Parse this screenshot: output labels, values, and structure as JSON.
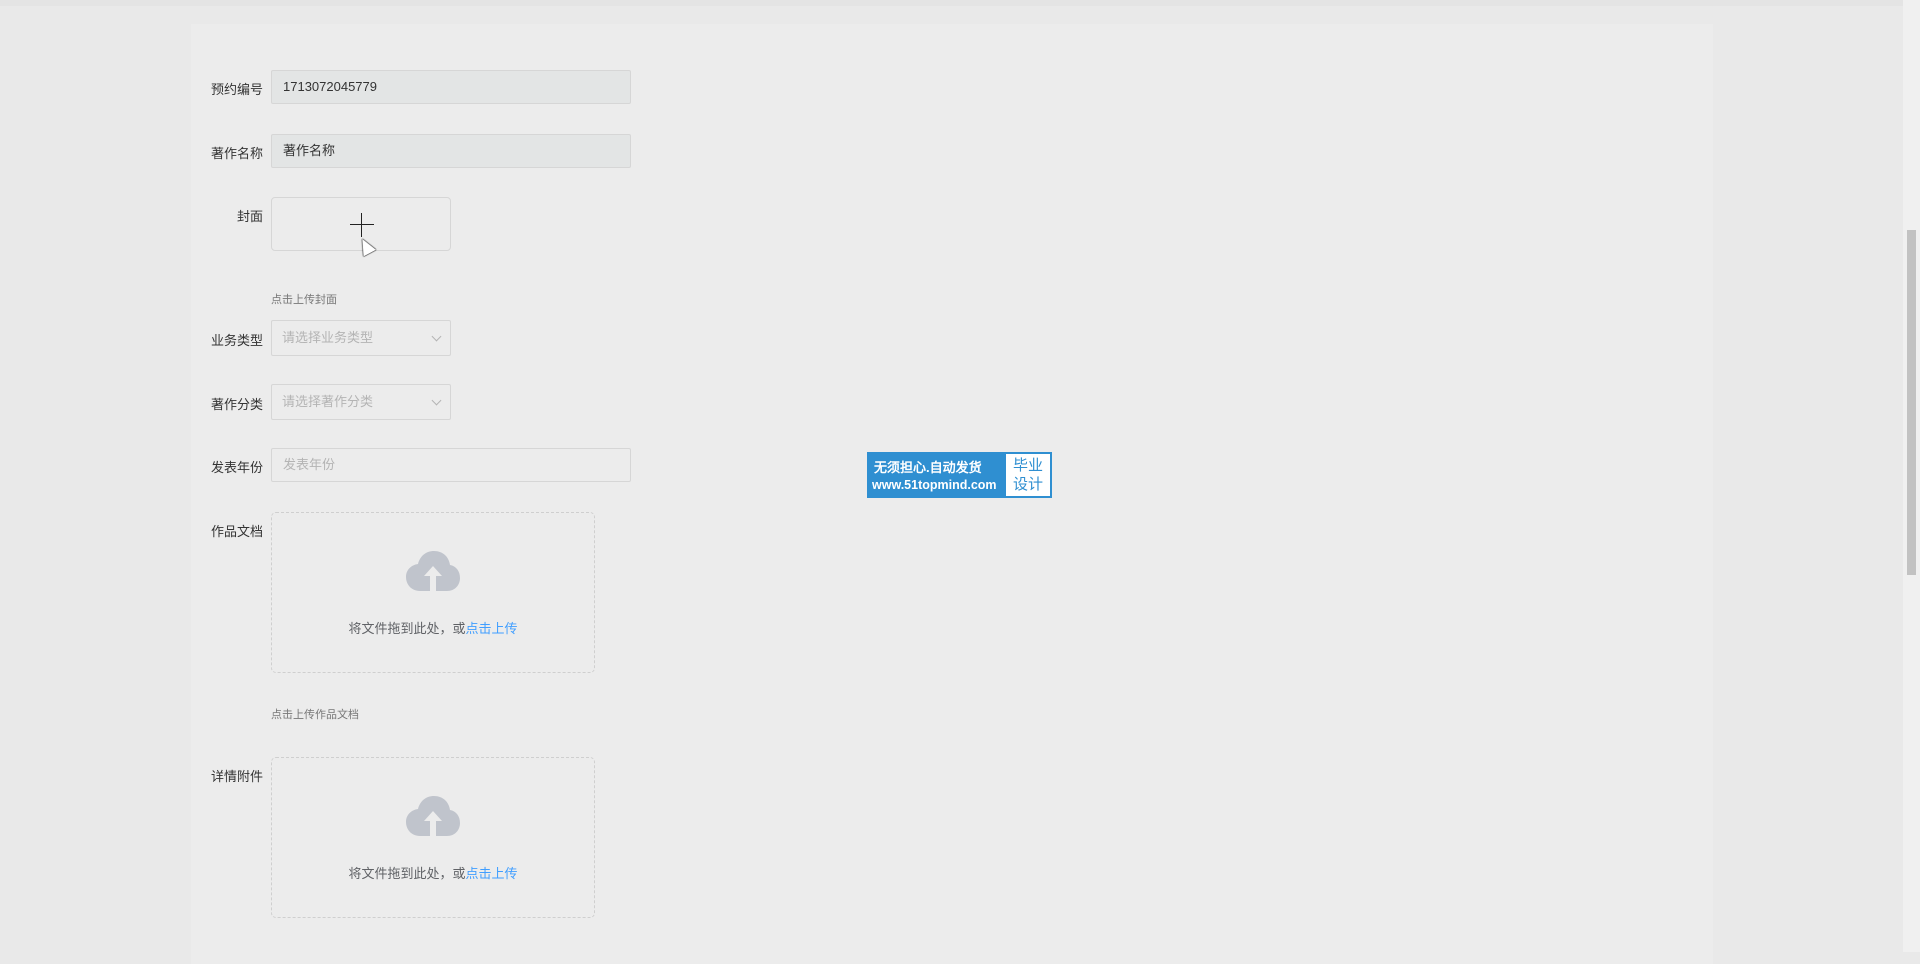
{
  "form": {
    "booking_no": {
      "label": "预约编号",
      "value": "1713072045779"
    },
    "work_name": {
      "label": "著作名称",
      "value": "著作名称"
    },
    "cover": {
      "label": "封面",
      "hint": "点击上传封面",
      "icon": "plus-icon"
    },
    "business_type": {
      "label": "业务类型",
      "placeholder": "请选择业务类型"
    },
    "work_category": {
      "label": "著作分类",
      "placeholder": "请选择著作分类"
    },
    "publish_year": {
      "label": "发表年份",
      "placeholder": "发表年份"
    },
    "work_document": {
      "label": "作品文档",
      "drop_text": "将文件拖到此处，或",
      "drop_link": "点击上传",
      "hint": "点击上传作品文档",
      "icon": "upload-cloud-icon"
    },
    "detail_attachment": {
      "label": "详情附件",
      "drop_text": "将文件拖到此处，或",
      "drop_link": "点击上传",
      "icon": "upload-cloud-icon"
    }
  },
  "watermark": {
    "line1": "无须担心.自动发货",
    "line2": "www.51topmind.com",
    "side_line1": "毕业",
    "side_line2": "设计"
  },
  "colors": {
    "link": "#409eff",
    "badge": "#2f8fd1",
    "background": "#e9e9e9"
  }
}
